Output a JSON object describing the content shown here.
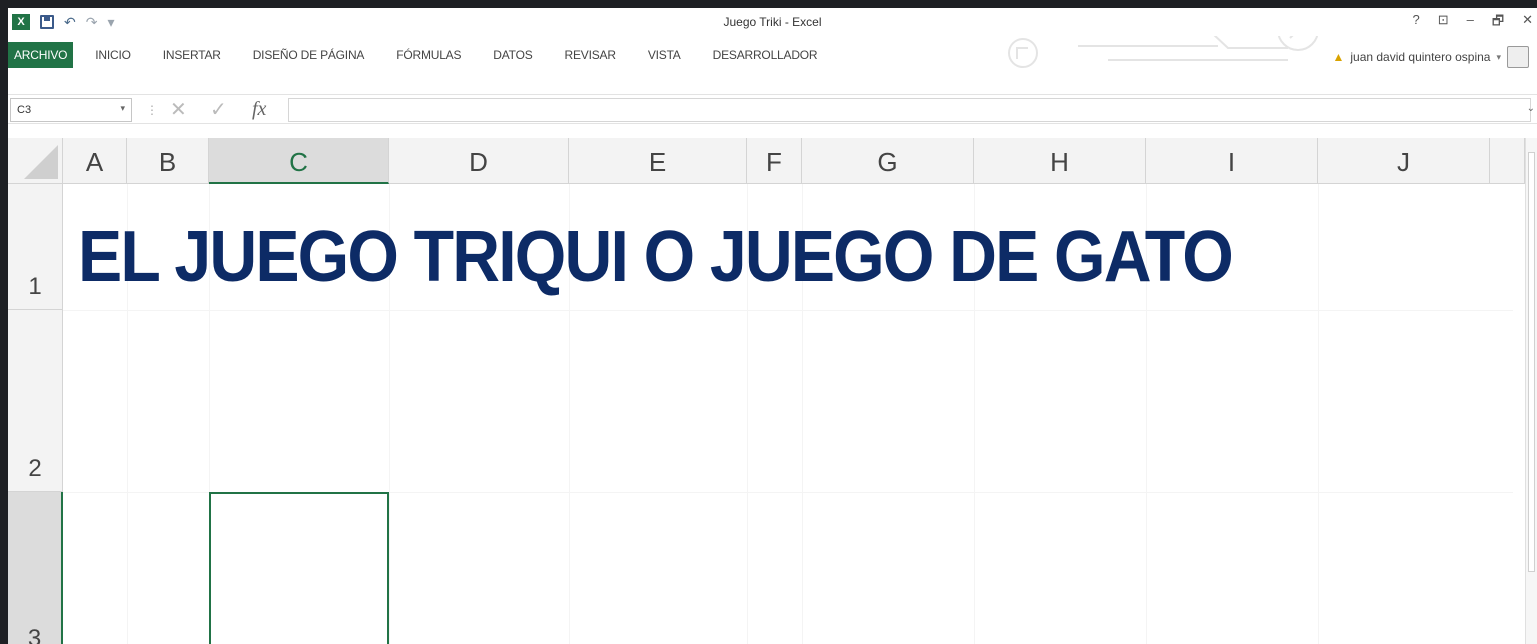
{
  "window": {
    "title": "Juego Triki - Excel",
    "controls": [
      "?",
      "⊡",
      "–",
      "🗗",
      "✕"
    ]
  },
  "qat": {
    "undo_glyph": "↶",
    "redo_glyph": "↷",
    "more_glyph": "▾"
  },
  "ribbon": {
    "tabs": [
      {
        "label": "ARCHIVO",
        "active": true
      },
      {
        "label": "INICIO"
      },
      {
        "label": "INSERTAR"
      },
      {
        "label": "DISEÑO DE PÁGINA"
      },
      {
        "label": "FÓRMULAS"
      },
      {
        "label": "DATOS"
      },
      {
        "label": "REVISAR"
      },
      {
        "label": "VISTA"
      },
      {
        "label": "DESARROLLADOR"
      }
    ],
    "user_name": "juan david quintero ospina",
    "user_caret": "▾"
  },
  "formula_bar": {
    "name_box": "C3",
    "cancel_glyph": "✕",
    "enter_glyph": "✓",
    "fx_label": "fx",
    "value": ""
  },
  "sheet": {
    "columns": [
      {
        "label": "A"
      },
      {
        "label": "B"
      },
      {
        "label": "C",
        "selected": true
      },
      {
        "label": "D"
      },
      {
        "label": "E"
      },
      {
        "label": "F"
      },
      {
        "label": "G"
      },
      {
        "label": "H"
      },
      {
        "label": "I"
      },
      {
        "label": "J"
      }
    ],
    "rows": [
      {
        "label": "1"
      },
      {
        "label": "2"
      },
      {
        "label": "3",
        "selected": true
      }
    ],
    "cell_a1": "EL JUEGO TRIQUI O JUEGO DE GATO",
    "active_cell": "C3"
  },
  "colors": {
    "excel_green": "#217346",
    "title_blue": "#0d2b66"
  }
}
